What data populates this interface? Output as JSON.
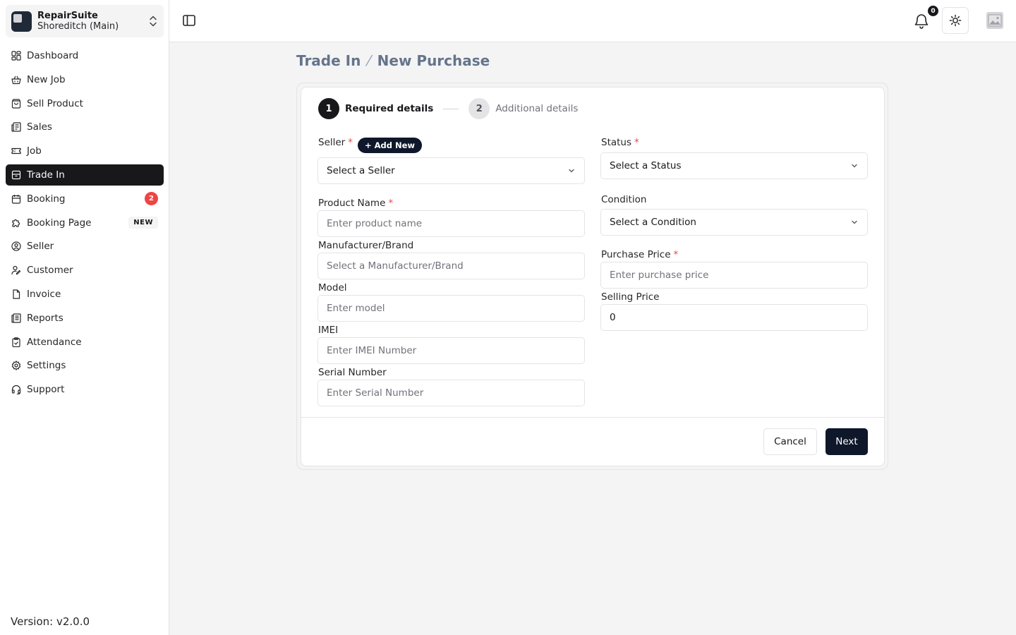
{
  "workspace": {
    "name": "RepairSuite",
    "branch": "Shoreditch (Main)"
  },
  "nav": {
    "items": [
      {
        "label": "Dashboard",
        "icon": "dashboard-icon"
      },
      {
        "label": "New Job",
        "icon": "basket-icon"
      },
      {
        "label": "Sell Product",
        "icon": "shopping-bag-icon"
      },
      {
        "label": "Sales",
        "icon": "receipt-icon"
      },
      {
        "label": "Job",
        "icon": "ticket-icon"
      },
      {
        "label": "Trade In",
        "icon": "archive-icon",
        "active": true
      },
      {
        "label": "Booking",
        "icon": "calendar-icon",
        "badge": "2"
      },
      {
        "label": "Booking Page",
        "icon": "puzzle-icon",
        "tag": "NEW"
      },
      {
        "label": "Seller",
        "icon": "user-circle-icon"
      },
      {
        "label": "Customer",
        "icon": "user-pen-icon"
      },
      {
        "label": "Invoice",
        "icon": "file-icon"
      },
      {
        "label": "Reports",
        "icon": "report-icon"
      },
      {
        "label": "Attendance",
        "icon": "clipboard-check-icon"
      },
      {
        "label": "Settings",
        "icon": "gear-icon"
      },
      {
        "label": "Support",
        "icon": "headset-icon"
      }
    ]
  },
  "version": "Version: v2.0.0",
  "topbar": {
    "notification_count": "0"
  },
  "breadcrumb": {
    "parent": "Trade In",
    "current": "New Purchase"
  },
  "steps": [
    {
      "num": "1",
      "label": "Required details",
      "active": true
    },
    {
      "num": "2",
      "label": "Additional details",
      "active": false
    }
  ],
  "form": {
    "seller_label": "Seller",
    "add_new_label": "+ Add New",
    "seller_value": "Select a Seller",
    "product_name_label": "Product Name",
    "product_name_placeholder": "Enter product name",
    "manufacturer_label": "Manufacturer/Brand",
    "manufacturer_placeholder": "Select a Manufacturer/Brand",
    "model_label": "Model",
    "model_placeholder": "Enter model",
    "imei_label": "IMEI",
    "imei_placeholder": "Enter IMEI Number",
    "serial_label": "Serial Number",
    "serial_placeholder": "Enter Serial Number",
    "status_label": "Status",
    "status_value": "Select a Status",
    "condition_label": "Condition",
    "condition_value": "Select a Condition",
    "purchase_price_label": "Purchase Price",
    "purchase_price_placeholder": "Enter purchase price",
    "selling_price_label": "Selling Price",
    "selling_price_value": "0",
    "required_mark": "*"
  },
  "actions": {
    "cancel": "Cancel",
    "next": "Next"
  },
  "colors": {
    "accent": "#18181b",
    "badge": "#ef4444",
    "required": "#ef4444",
    "primary_button": "#0f172a"
  }
}
